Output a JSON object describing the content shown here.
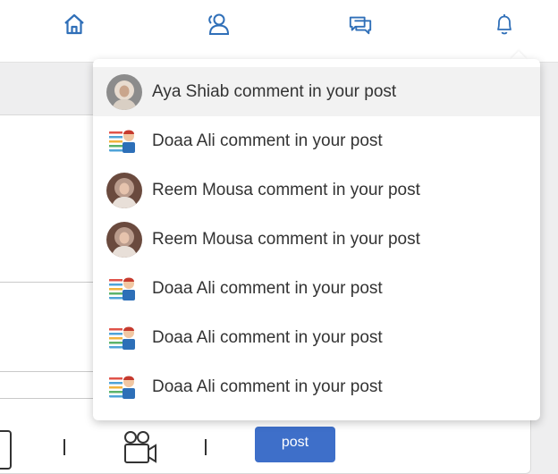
{
  "nav": {
    "icons": [
      "home-icon",
      "friends-icon",
      "messages-icon",
      "bell-icon"
    ],
    "accent_color": "#2f6fb8"
  },
  "notifications": [
    {
      "text": "Aya Shiab comment in your post",
      "avatar": "photo-avatar-light",
      "active": true
    },
    {
      "text": "Doaa Ali comment in your post",
      "avatar": "cartoon-avatar"
    },
    {
      "text": "Reem Mousa comment in your post",
      "avatar": "photo-avatar-dark"
    },
    {
      "text": "Reem Mousa comment in your post",
      "avatar": "photo-avatar-dark"
    },
    {
      "text": "Doaa Ali comment in your post",
      "avatar": "cartoon-avatar"
    },
    {
      "text": "Doaa Ali comment in your post",
      "avatar": "cartoon-avatar"
    },
    {
      "text": "Doaa Ali comment in your post",
      "avatar": "cartoon-avatar"
    }
  ],
  "composer": {
    "post_label": "post",
    "post_color": "#3e6fc9"
  }
}
